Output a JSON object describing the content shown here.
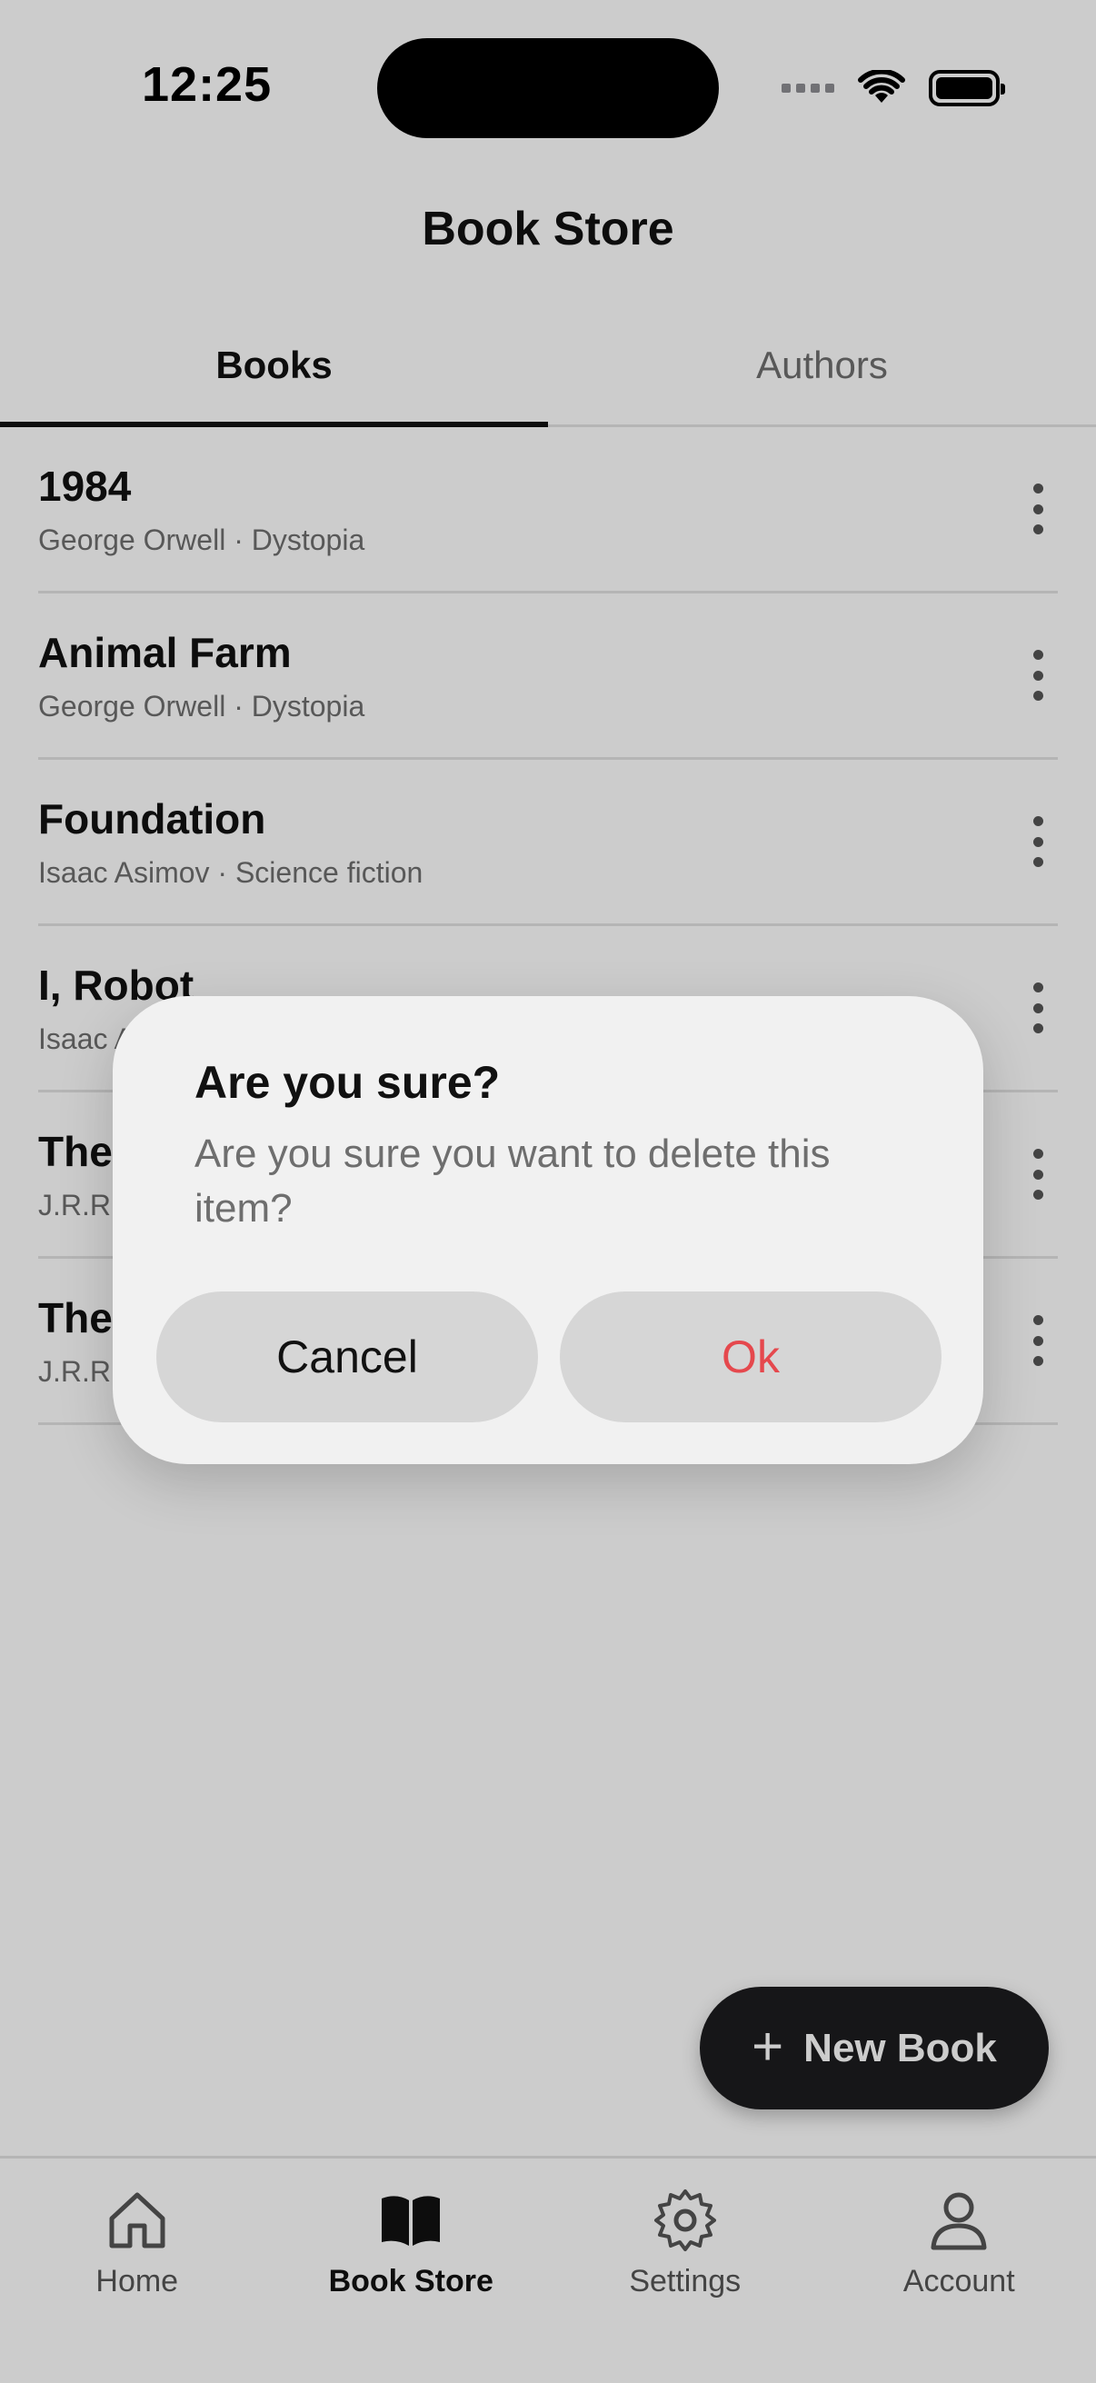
{
  "status_bar": {
    "time": "12:25"
  },
  "header": {
    "title": "Book Store"
  },
  "tabs": [
    {
      "label": "Books",
      "active": true
    },
    {
      "label": "Authors",
      "active": false
    }
  ],
  "books": [
    {
      "title": "1984",
      "subtitle": "George Orwell · Dystopia"
    },
    {
      "title": "Animal Farm",
      "subtitle": "George Orwell · Dystopia"
    },
    {
      "title": "Foundation",
      "subtitle": "Isaac Asimov · Science fiction"
    },
    {
      "title": "I, Robot",
      "subtitle": "Isaac A"
    },
    {
      "title": "The",
      "subtitle": "J.R.R."
    },
    {
      "title": "The",
      "subtitle": "J.R.R."
    }
  ],
  "fab": {
    "label": "New Book",
    "icon": "plus-icon"
  },
  "bottom_nav": [
    {
      "label": "Home",
      "icon": "home-icon",
      "active": false
    },
    {
      "label": "Book Store",
      "icon": "book-icon",
      "active": true
    },
    {
      "label": "Settings",
      "icon": "gear-icon",
      "active": false
    },
    {
      "label": "Account",
      "icon": "person-icon",
      "active": false
    }
  ],
  "dialog": {
    "title": "Are you sure?",
    "message": "Are you sure you want to delete this item?",
    "cancel_label": "Cancel",
    "ok_label": "Ok"
  },
  "colors": {
    "destructive": "#e5484d",
    "fab_background": "#1c1c1e",
    "scrim": "rgba(0,0,0,0.20)"
  }
}
